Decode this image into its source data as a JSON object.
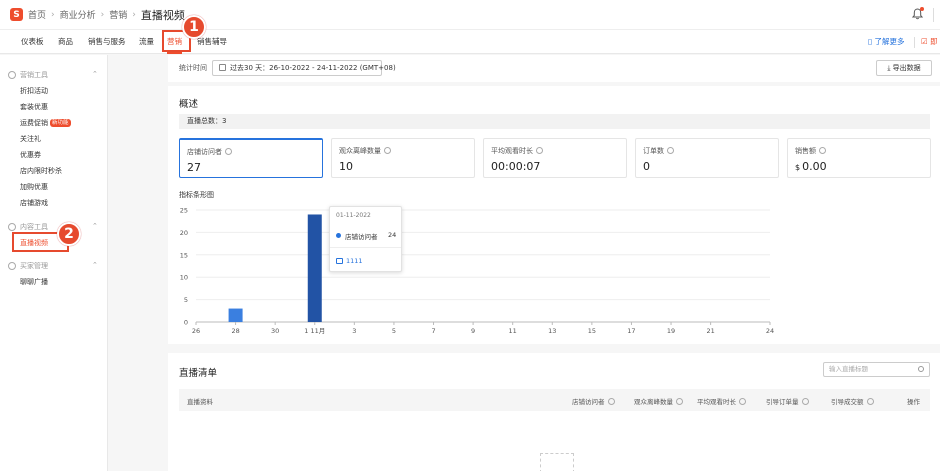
{
  "colors": {
    "brand": "#ee4d2d",
    "accent": "#2673dd",
    "bar_dark": "#2253a5",
    "bar_light": "#3a7fe0"
  },
  "header": {
    "logo_icon": "shopee-bag-icon",
    "breadcrumb": [
      "首页",
      "商业分析",
      "营销",
      "直播视频"
    ]
  },
  "nav": {
    "tabs": [
      "仪表板",
      "商品",
      "销售与服务",
      "流量",
      "营销",
      "销售辅导"
    ],
    "active": 4,
    "learn_more": "了解更多",
    "right_link": "即"
  },
  "sidebar": {
    "sections": [
      {
        "title": "营销工具",
        "items": [
          "折扣活动",
          "套装优惠",
          "运费促销",
          "关注礼",
          "优惠券",
          "店内限时秒杀",
          "加购优惠",
          "店铺游戏"
        ],
        "badge_item": 2,
        "badge": "新功能"
      },
      {
        "title": "内容工具",
        "items": [
          "直播视频"
        ],
        "active_item": 0
      },
      {
        "title": "买家管理",
        "items": [
          "聊聊广播"
        ]
      }
    ]
  },
  "annotations": [
    "1",
    "2"
  ],
  "time": {
    "label": "统计时间",
    "range_prefix": "过去30 天：",
    "range": "26-10-2022 - 24-11-2022 (GMT+08)",
    "export": "导出数据"
  },
  "overview": {
    "title": "概述",
    "live_count": "直播总数：3",
    "metrics": [
      {
        "label": "店铺访问者",
        "value": "27"
      },
      {
        "label": "观众离峰数量",
        "value": "10"
      },
      {
        "label": "平均观看时长",
        "value": "00:00:07"
      },
      {
        "label": "订单数",
        "value": "0"
      },
      {
        "label": "销售额",
        "currency": "$",
        "value": "0.00"
      }
    ],
    "chart_title": "指标条形图"
  },
  "chart_data": {
    "type": "bar",
    "x": [
      "26",
      "27",
      "28",
      "29",
      "30",
      "31",
      "1 11月",
      "2",
      "3",
      "4",
      "5",
      "6",
      "7",
      "8",
      "9",
      "10",
      "11",
      "12",
      "13",
      "14",
      "15",
      "16",
      "17",
      "18",
      "19",
      "20",
      "21",
      "22",
      "23",
      "24"
    ],
    "x_tick_labels": [
      "26",
      "28",
      "30",
      "1 11月",
      "3",
      "5",
      "7",
      "9",
      "11",
      "13",
      "15",
      "17",
      "19",
      "21",
      "24"
    ],
    "series": [
      {
        "name": "店铺访问者",
        "values": [
          0,
          0,
          3,
          0,
          0,
          0,
          24,
          0,
          0,
          0,
          0,
          0,
          0,
          0,
          0,
          0,
          0,
          0,
          0,
          0,
          0,
          0,
          0,
          0,
          0,
          0,
          0,
          0,
          0,
          0
        ]
      }
    ],
    "highlight_index": 6,
    "ylim": [
      0,
      25
    ],
    "yticks": [
      0,
      5,
      10,
      15,
      20,
      25
    ],
    "grid": true
  },
  "tooltip": {
    "date": "01-11-2022",
    "name": "店铺访问者",
    "value": "24",
    "live_title": "1111"
  },
  "list": {
    "title": "直播清单",
    "search_placeholder": "输入直播标题",
    "columns": [
      "直播资料",
      "店铺访问者",
      "观众离峰数量",
      "平均观看时长",
      "引导订单量",
      "引导成交额",
      "操作"
    ]
  }
}
